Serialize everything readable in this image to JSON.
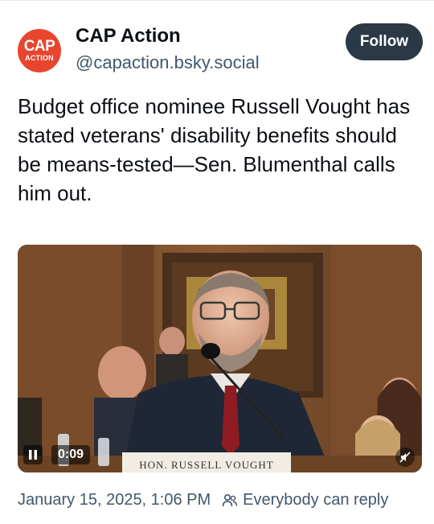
{
  "author": {
    "avatar_line1": "CAP",
    "avatar_line2": "ACTION",
    "display_name": "CAP Action",
    "handle": "@capaction.bsky.social",
    "brand_color": "#e8452f"
  },
  "follow_button": {
    "label": "Follow"
  },
  "post": {
    "text": "Budget office nominee Russell Vought has stated veterans' disability benefits should be means-tested—Sen. Blumenthal calls him out."
  },
  "video": {
    "time": "0:09",
    "nameplate": "HON. RUSSELL VOUGHT",
    "pause_icon": "pause-icon",
    "mute_icon": "mute-icon"
  },
  "meta": {
    "timestamp": "January 15, 2025, 1:06 PM",
    "reply_setting": "Everybody can reply",
    "reply_icon": "people-icon"
  }
}
